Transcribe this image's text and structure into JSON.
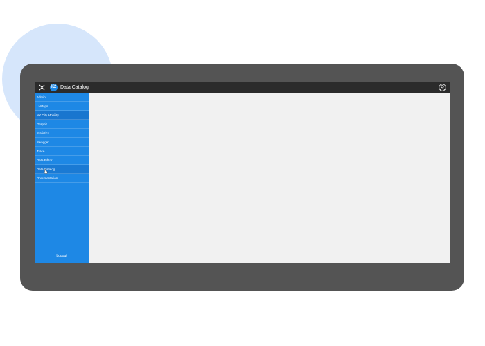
{
  "header": {
    "title": "Data Catalog",
    "logo_text": "K2",
    "close_icon": "close-icon",
    "user_icon": "user-account-icon"
  },
  "sidebar": {
    "items": [
      {
        "label": "Admin",
        "state": "normal"
      },
      {
        "label": "LI-Maps",
        "state": "normal"
      },
      {
        "label": "NY City Mobility",
        "state": "active"
      },
      {
        "label": "Graphit",
        "state": "normal"
      },
      {
        "label": "Statistics",
        "state": "normal"
      },
      {
        "label": "Swagger",
        "state": "normal"
      },
      {
        "label": "Trace",
        "state": "normal"
      },
      {
        "label": "Data Editor",
        "state": "normal"
      },
      {
        "label": "Data Catalog",
        "state": "hover"
      },
      {
        "label": "Documentation",
        "state": "normal"
      }
    ],
    "logout_label": "Logout"
  },
  "colors": {
    "sidebar": "#1e88e5",
    "topbar": "#2b2b2b",
    "device_frame": "#545454",
    "content_bg": "#f1f1f1",
    "decor_circle": "#d6e6fb"
  }
}
